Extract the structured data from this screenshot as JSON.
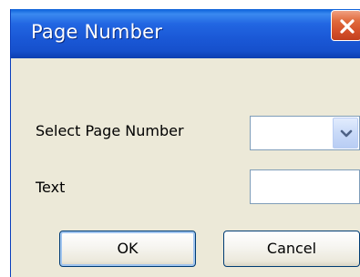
{
  "window": {
    "title": "Page Number"
  },
  "form": {
    "page_number_label": "Select Page Number",
    "page_number_value": "",
    "text_label": "Text",
    "text_value": ""
  },
  "buttons": {
    "ok": "OK",
    "cancel": "Cancel"
  },
  "icons": {
    "close": "close-icon",
    "dropdown": "chevron-down-icon"
  },
  "colors": {
    "titlebar": "#2266e2",
    "close_button": "#d4502a",
    "dialog_background": "#ece9d8"
  }
}
